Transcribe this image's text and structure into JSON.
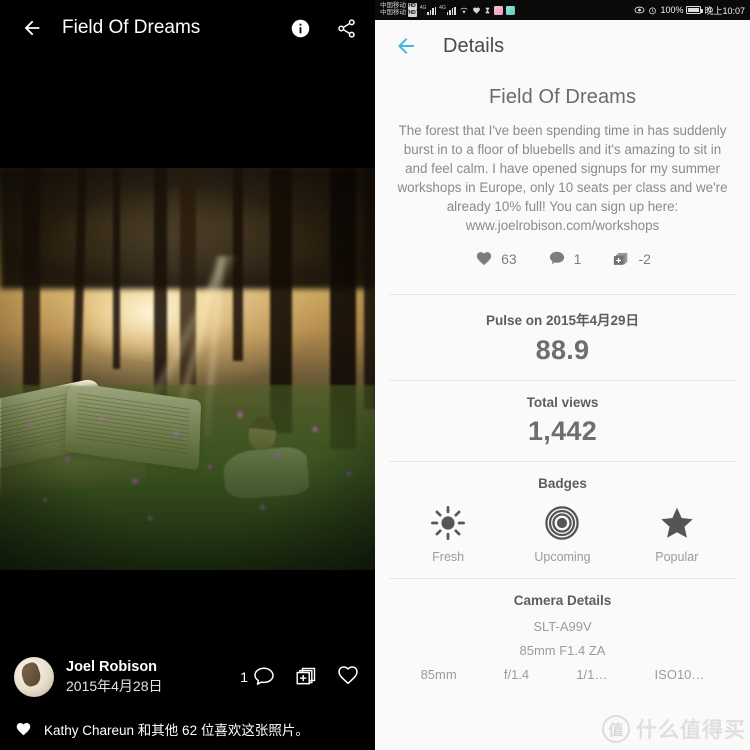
{
  "left": {
    "appbar": {
      "back_icon": "arrow-left-icon",
      "title": "Field Of Dreams",
      "info_icon": "info-icon",
      "share_icon": "share-icon"
    },
    "photo": {
      "alt": "Man lying in a bluebell forest beside a giant open book at sunset"
    },
    "meta": {
      "author": "Joel Robison",
      "date": "2015年4月28日",
      "comment_count": "1",
      "comment_icon": "comment-icon",
      "add-to-collection_icon": "add-to-collection-icon",
      "like_icon": "heart-outline-icon"
    },
    "likes": {
      "heart_icon": "heart-filled-icon",
      "text": "Kathy Chareun 和其他 62 位喜欢这张照片。"
    }
  },
  "right": {
    "statusbar": {
      "carrier_1": "中国移动",
      "carrier_2": "中国移动",
      "hd_badge": "HD",
      "net_1": "4G",
      "net_2": "4G",
      "wifi_icon": "wifi-icon",
      "wifi_sup": "2",
      "heart_icon": "heart-icon",
      "hourglass_icon": "hourglass-icon",
      "app_icon_1": "gallery-app-icon",
      "app_icon_2": "teal-app-icon",
      "eye_icon": "eye-icon",
      "alarm_icon": "alarm-icon",
      "battery_percent": "100%",
      "battery_icon": "battery-icon",
      "time": "晚上10:07"
    },
    "appbar": {
      "back_icon": "arrow-left-icon",
      "title": "Details",
      "back_color": "#4ab3e3"
    },
    "photo": {
      "title": "Field Of Dreams",
      "description": "The forest that I've been spending time in has suddenly burst in to a floor of bluebells and it's amazing to sit in and feel calm. I have opened signups for my summer workshops in Europe, only 10 seats per class and we're already 10% full! You can sign up here: www.joelrobison.com/workshops"
    },
    "stats": [
      {
        "icon": "heart-filled-icon",
        "value": "63"
      },
      {
        "icon": "comment-icon",
        "value": "1"
      },
      {
        "icon": "add-to-collection-icon",
        "value": "-2"
      }
    ],
    "pulse": {
      "label": "Pulse on 2015年4月29日",
      "value": "88.9"
    },
    "views": {
      "label": "Total views",
      "value": "1,442"
    },
    "badges": {
      "title": "Badges",
      "items": [
        {
          "icon": "sun-icon",
          "label": "Fresh"
        },
        {
          "icon": "target-icon",
          "label": "Upcoming"
        },
        {
          "icon": "star-icon",
          "label": "Popular"
        }
      ]
    },
    "camera": {
      "title": "Camera Details",
      "body": "SLT-A99V",
      "lens": "85mm F1.4 ZA",
      "specs": [
        "85mm",
        "f/1.4",
        "1/1…",
        "ISO10…"
      ]
    },
    "watermark": {
      "logo": "值",
      "text": "什么值得买"
    }
  }
}
